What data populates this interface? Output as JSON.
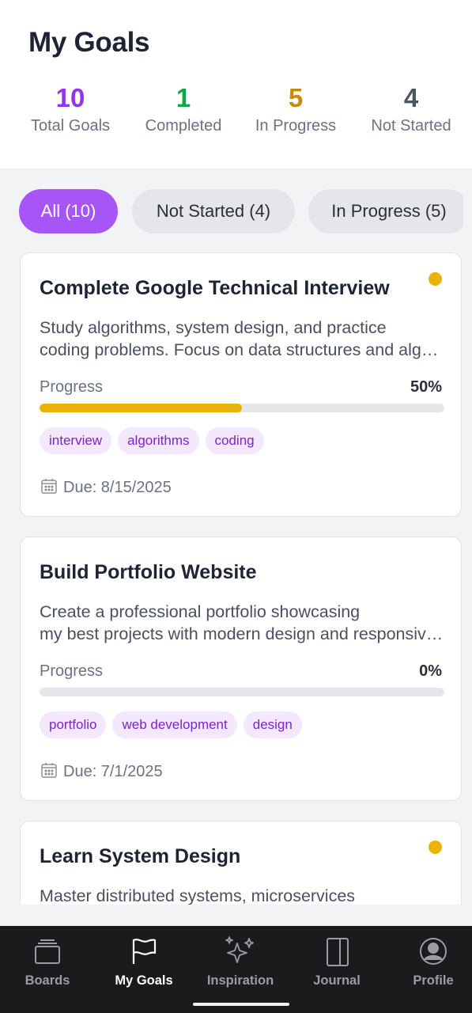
{
  "header": {
    "title": "My Goals"
  },
  "stats": [
    {
      "value": "10",
      "label": "Total Goals",
      "color": "#9333ea"
    },
    {
      "value": "1",
      "label": "Completed",
      "color": "#16a34a"
    },
    {
      "value": "5",
      "label": "In Progress",
      "color": "#ca8a04"
    },
    {
      "value": "4",
      "label": "Not Started",
      "color": "#4b5563"
    }
  ],
  "filters": [
    {
      "label": "All (10)",
      "active": true
    },
    {
      "label": "Not Started (4)",
      "active": false
    },
    {
      "label": "In Progress (5)",
      "active": false
    }
  ],
  "goals": [
    {
      "title": "Complete Google Technical Interview",
      "desc_line1": "Study algorithms, system design, and practice",
      "desc_line2": "coding problems. Focus on data structures and algorithms.",
      "progress_label": "Progress",
      "progress_text": "50%",
      "progress": 0.5,
      "status_dot": true,
      "tags": [
        "interview",
        "algorithms",
        "coding"
      ],
      "due": "Due: 8/15/2025"
    },
    {
      "title": "Build Portfolio Website",
      "desc_line1": "Create a professional portfolio showcasing",
      "desc_line2": "my best projects with modern design and responsive layout.",
      "progress_label": "Progress",
      "progress_text": "0%",
      "progress": 0,
      "status_dot": false,
      "tags": [
        "portfolio",
        "web development",
        "design"
      ],
      "due": "Due: 7/1/2025"
    },
    {
      "title": "Learn System Design",
      "desc_line1": "Master distributed systems, microservices",
      "status_dot": true
    }
  ],
  "nav": [
    {
      "label": "Boards",
      "icon": "boards-icon",
      "active": false
    },
    {
      "label": "My Goals",
      "icon": "flag-icon",
      "active": true
    },
    {
      "label": "Inspiration",
      "icon": "sparkles-icon",
      "active": false
    },
    {
      "label": "Journal",
      "icon": "journal-icon",
      "active": false
    },
    {
      "label": "Profile",
      "icon": "profile-icon",
      "active": false
    }
  ],
  "colors": {
    "accent": "#a855f7",
    "progress": "#eab308",
    "tag_bg": "#f3e8ff",
    "tag_text": "#7e22ce"
  }
}
